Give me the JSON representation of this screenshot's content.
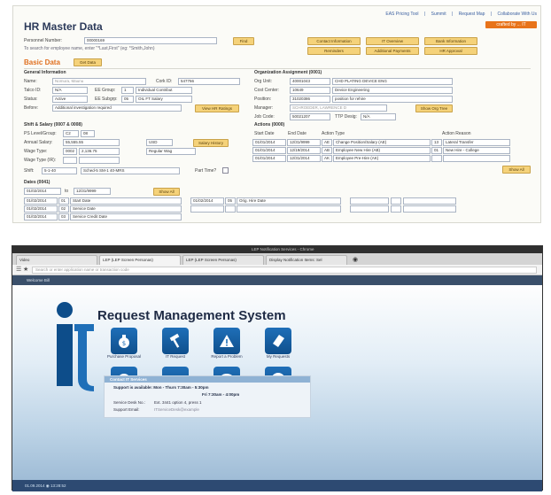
{
  "hr": {
    "title": "HR Master Data",
    "top_links": [
      "EAS Pricing Tool",
      "Summit",
      "Request Map",
      "Collaborate With Us"
    ],
    "crafted_label": "crafted by ... IT",
    "personnel_label": "Personnel Number:",
    "personnel_value": "00000169",
    "find_button": "Find",
    "hint": "To search for employee name, enter \"*Last,First\" (eg: *Smith,John)",
    "nav_buttons": [
      "Contact Information",
      "IT Overview",
      "Bank Information",
      "Reminders",
      "Additional Payments",
      "HR Approval"
    ],
    "basic_data_title": "Basic Data",
    "get_data_button": "Get Data",
    "general_title": "General Information",
    "general": {
      "name_label": "Name:",
      "name_value": "Nomura, Maunu",
      "cork_label": "Cork ID:",
      "cork_value": "547766",
      "talco_label": "Talco ID:",
      "talco_value": "N/A",
      "ee_group_label": "EE Group:",
      "ee_group_code": "1",
      "ee_group_text": "Individual Contribut",
      "status_label": "Status:",
      "status_value": "Active",
      "ee_subgrp_label": "EE Subgrp:",
      "ee_subgrp_code": "05",
      "ee_subgrp_text": "OIL FT Salary",
      "before_label": "Before:",
      "before_value": "Additional investigation required",
      "view_button": "View HR Ratings"
    },
    "org_title": "Organization Assignment (0001)",
    "org": {
      "org_unit_label": "Org Unit:",
      "org_unit_code": "40001043",
      "org_unit_text": "CHD PLATING DEVICE ENG",
      "cost_center_label": "Cost Center:",
      "cost_center_code": "10649",
      "cost_center_text": "Device Engineering",
      "position_label": "Position:",
      "position_code": "31020386",
      "position_text": "position for rehire",
      "manager_label": "Manager:",
      "manager_value": "SCHROEDER, LAWRENCE D",
      "org_chart_button": "Show Org Tree",
      "job_code_label": "Job Code:",
      "job_code_value": "50021207",
      "ttp_label": "TTP Desig:",
      "ttp_value": "N/A"
    },
    "shift_title": "Shift & Salary (0007 & 0008)",
    "shift": {
      "ps_label": "PS Level/Group:",
      "ps_level": "C2",
      "ps_group": "08",
      "salary_label": "Annual Salary:",
      "salary_value": "55,555.55",
      "currency": "USD",
      "salary_button": "Salary History",
      "wage_label": "Wage Type:",
      "wage_code": "0002",
      "wage_amount": "2,136.75",
      "wage_text": "Regular Wag",
      "wage2_label": "Wage Type (IR):",
      "shift_label": "Shift:",
      "shift_code": "5-1-40",
      "shift_text": "Sched-5 SM-1 40-MRS",
      "parttime_label": "Part Time?"
    },
    "actions_title": "Actions (0000)",
    "actions": {
      "headers": [
        "Start Date",
        "End Date",
        "Action Type",
        "Action Reason"
      ],
      "rows": [
        [
          "01/01/2014",
          "12/31/9999",
          "AE",
          "Change Position/Salary (AE)",
          "13",
          "Lateral Transfer"
        ],
        [
          "01/01/2014",
          "12/19/2014",
          "AB",
          "Employee New Hire (AB)",
          "01",
          "New Hire - College"
        ],
        [
          "01/01/2014",
          "12/31/2014",
          "AK",
          "Employee Pre-Hire (AK)",
          "",
          ""
        ]
      ],
      "show_all_button": "Show All"
    },
    "dates_title": "Dates (0041)",
    "dates": {
      "from": "01/02/2014",
      "to_label": "to",
      "to": "12/31/9999",
      "show_all_button": "Show All",
      "rows_left": [
        [
          "01/02/2014",
          "01",
          "Start Date"
        ],
        [
          "01/02/2014",
          "02",
          "Service Date"
        ],
        [
          "01/02/2014",
          "03",
          "Service Credit Date"
        ]
      ],
      "rows_right": [
        [
          "01/02/2014",
          "05",
          "Orig. Hire Date"
        ]
      ]
    }
  },
  "browser": {
    "window_title": "LEP Notification Services - Chrome",
    "tabs": [
      "Video",
      "LEP (LEP Screen Personas)",
      "LEP (LEP Screen Personas)",
      "Display Notification Items: Sel"
    ],
    "address_placeholder": "Search or enter application name or transaction code",
    "welcome": "Welcome  Bill",
    "rms_title": "Request Management System",
    "tiles": [
      {
        "label": "Purchase Proposal",
        "icon": "money-bag-icon"
      },
      {
        "label": "IT Request",
        "icon": "hammer-icon"
      },
      {
        "label": "Report a Problem",
        "icon": "warning-icon"
      },
      {
        "label": "My Requests",
        "icon": "document-icon"
      },
      {
        "label": "Request Approvals",
        "icon": "checkmark-icon"
      },
      {
        "label": "My Profile",
        "icon": "profile-card-icon"
      },
      {
        "label": "Suggestions",
        "icon": "star-chat-icon"
      },
      {
        "label": "Help",
        "icon": "question-icon"
      }
    ],
    "info_title": "Contact IT Services",
    "info_line1": "Support is available: Mon - Thurs 7:30am - 5:30pm",
    "info_line2": "Fri 7:30am - 4:00pm",
    "info_line3_label": "Service Desk No.:",
    "info_line3_value": "Ext. 3441 option 4, press 1",
    "info_line4_label": "Support Email:",
    "info_line4_value": "ITServiceDesk@example",
    "status_time": "01.09.2014  ◉  13:28:52",
    "colors": {
      "brand_orange": "#e8731a",
      "tile_blue": "#1f6fb8",
      "logo_blue": "#0d4d8a"
    }
  }
}
